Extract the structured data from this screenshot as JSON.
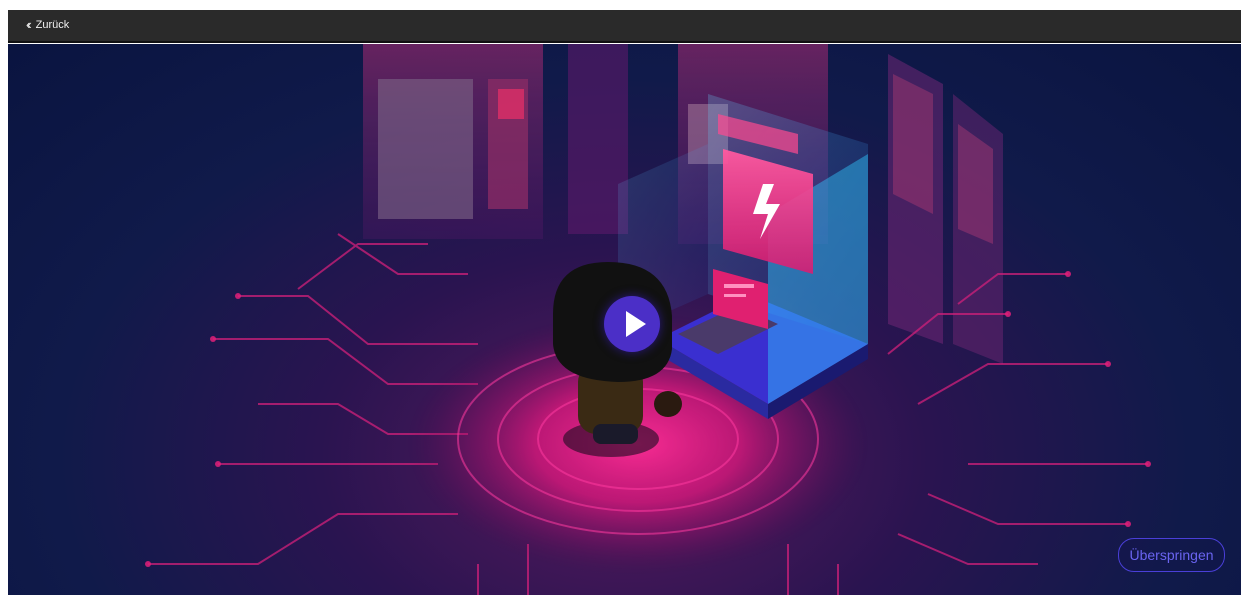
{
  "header": {
    "back_icon": "double-chevron-left-icon",
    "back_label": "Zurück"
  },
  "video": {
    "play_icon": "play-icon",
    "skip_label": "Überspringen",
    "accent_color": "#4b2fc7",
    "glow_color": "#ff1a8c"
  }
}
